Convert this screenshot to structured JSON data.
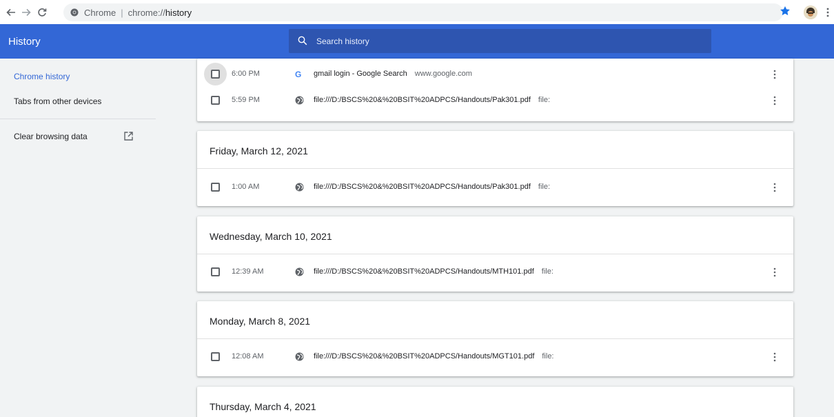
{
  "toolbar": {
    "omnibox_label": "Chrome",
    "omnibox_separator": "|",
    "url_host": "chrome://",
    "url_path": "history",
    "icons": [
      "back-arrow-icon",
      "forward-arrow-icon",
      "reload-icon",
      "chrome-icon",
      "star-icon",
      "avatar",
      "more-vert-icon"
    ],
    "star_color": "#1a73e8"
  },
  "header": {
    "title": "History",
    "search_placeholder": "Search history",
    "color": "#3367d6"
  },
  "sidebar": {
    "items": [
      {
        "label": "Chrome history",
        "active": true
      },
      {
        "label": "Tabs from other devices",
        "active": false
      },
      {
        "label": "Clear browsing data",
        "active": false
      }
    ],
    "accent": "#3367d6"
  },
  "groups": [
    {
      "date": "",
      "entries": [
        {
          "time": "6:00 PM",
          "title": "gmail login - Google Search",
          "domain": "www.google.com",
          "favicon": "google-icon"
        },
        {
          "time": "5:59 PM",
          "title": "file:///D:/BSCS%20&%20BSIT%20ADPCS/Handouts/Pak301.pdf",
          "domain": "file:",
          "favicon": "globe-icon"
        }
      ]
    },
    {
      "date": "Friday, March 12, 2021",
      "entries": [
        {
          "time": "1:00 AM",
          "title": "file:///D:/BSCS%20&%20BSIT%20ADPCS/Handouts/Pak301.pdf",
          "domain": "file:",
          "favicon": "globe-icon"
        }
      ]
    },
    {
      "date": "Wednesday, March 10, 2021",
      "entries": [
        {
          "time": "12:39 AM",
          "title": "file:///D:/BSCS%20&%20BSIT%20ADPCS/Handouts/MTH101.pdf",
          "domain": "file:",
          "favicon": "globe-icon"
        }
      ]
    },
    {
      "date": "Monday, March 8, 2021",
      "entries": [
        {
          "time": "12:08 AM",
          "title": "file:///D:/BSCS%20&%20BSIT%20ADPCS/Handouts/MGT101.pdf",
          "domain": "file:",
          "favicon": "globe-icon"
        }
      ]
    },
    {
      "date": "Thursday, March 4, 2021",
      "entries": []
    }
  ]
}
